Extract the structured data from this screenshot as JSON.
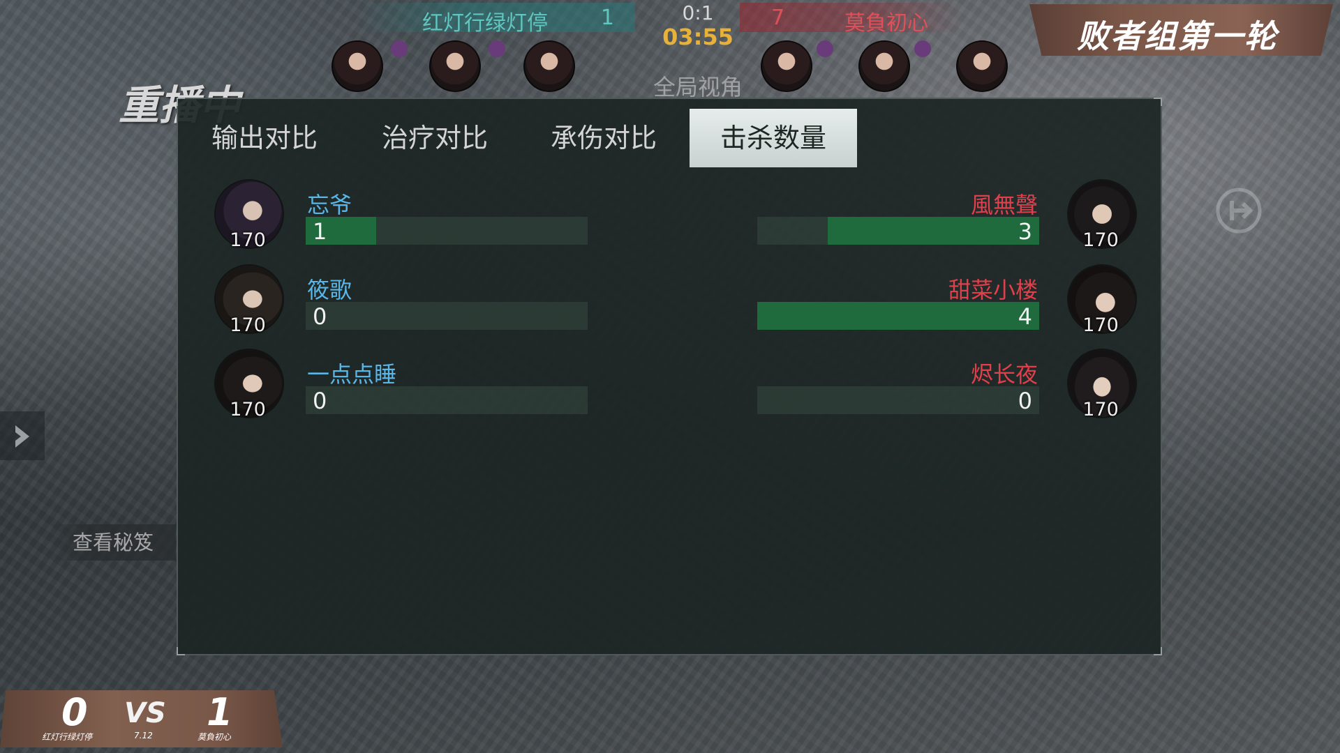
{
  "top": {
    "left_team": "红灯行绿灯停",
    "left_team_score": "1",
    "match_score": "0:1",
    "timer": "03:55",
    "view_label": "全局视角",
    "right_team_score": "7",
    "right_team": "莫負初心"
  },
  "round_title": "败者组第一轮",
  "replay_label": "重播中",
  "secret_button": "查看秘笈",
  "tabs": [
    {
      "label": "输出对比",
      "active": false
    },
    {
      "label": "治疗对比",
      "active": false
    },
    {
      "label": "承伤对比",
      "active": false
    },
    {
      "label": "击杀数量",
      "active": true
    }
  ],
  "stat": {
    "max": 4
  },
  "left_players": [
    {
      "name": "忘爷",
      "level": "170",
      "value": "1",
      "amount": 1
    },
    {
      "name": "筱歌",
      "level": "170",
      "value": "0",
      "amount": 0
    },
    {
      "name": "一点点睡",
      "level": "170",
      "value": "0",
      "amount": 0
    }
  ],
  "right_players": [
    {
      "name": "風無聲",
      "level": "170",
      "value": "3",
      "amount": 3
    },
    {
      "name": "甜菜小楼",
      "level": "170",
      "value": "4",
      "amount": 4
    },
    {
      "name": "烬长夜",
      "level": "170",
      "value": "0",
      "amount": 0
    }
  ],
  "series": {
    "left_score": "0",
    "vs": "VS",
    "right_score": "1",
    "left_team": "红灯行绿灯停",
    "date": "7.12",
    "right_team": "莫負初心"
  },
  "colors": {
    "left_team": "#5ab6e6",
    "right_team": "#e0404c",
    "bar_fill": "#1f6b3e",
    "timer": "#e7b13a"
  }
}
